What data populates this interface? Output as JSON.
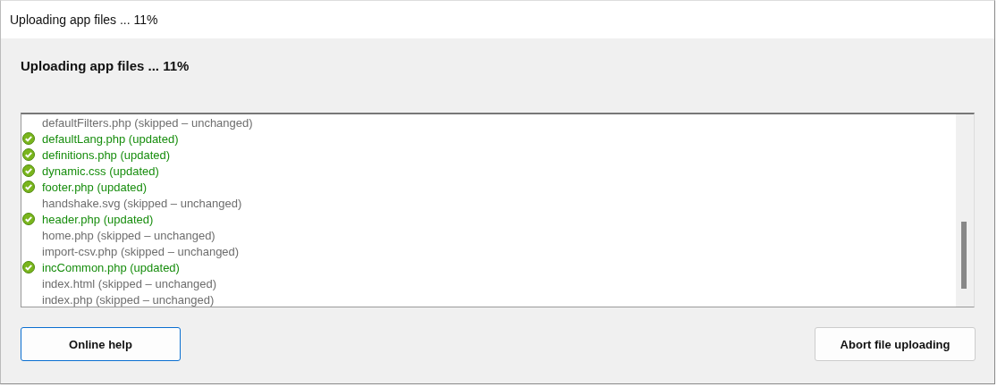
{
  "window": {
    "title": "Uploading app files ... 11%"
  },
  "heading": "Uploading app files ... 11%",
  "files": [
    {
      "text": "defaultFilters.php (skipped – unchanged)",
      "kind": "skipped"
    },
    {
      "text": "defaultLang.php (updated)",
      "kind": "updated"
    },
    {
      "text": "definitions.php (updated)",
      "kind": "updated"
    },
    {
      "text": "dynamic.css (updated)",
      "kind": "updated"
    },
    {
      "text": "footer.php (updated)",
      "kind": "updated"
    },
    {
      "text": "handshake.svg (skipped – unchanged)",
      "kind": "skipped"
    },
    {
      "text": "header.php (updated)",
      "kind": "updated"
    },
    {
      "text": "home.php (skipped – unchanged)",
      "kind": "skipped"
    },
    {
      "text": "import-csv.php (skipped – unchanged)",
      "kind": "skipped"
    },
    {
      "text": "incCommon.php (updated)",
      "kind": "updated"
    },
    {
      "text": "index.html (skipped – unchanged)",
      "kind": "skipped"
    },
    {
      "text": "index.php (skipped – unchanged)",
      "kind": "skipped"
    }
  ],
  "buttons": [
    {
      "label": "Online help",
      "focused": true
    },
    {
      "label": "Abort file uploading",
      "focused": false
    }
  ]
}
